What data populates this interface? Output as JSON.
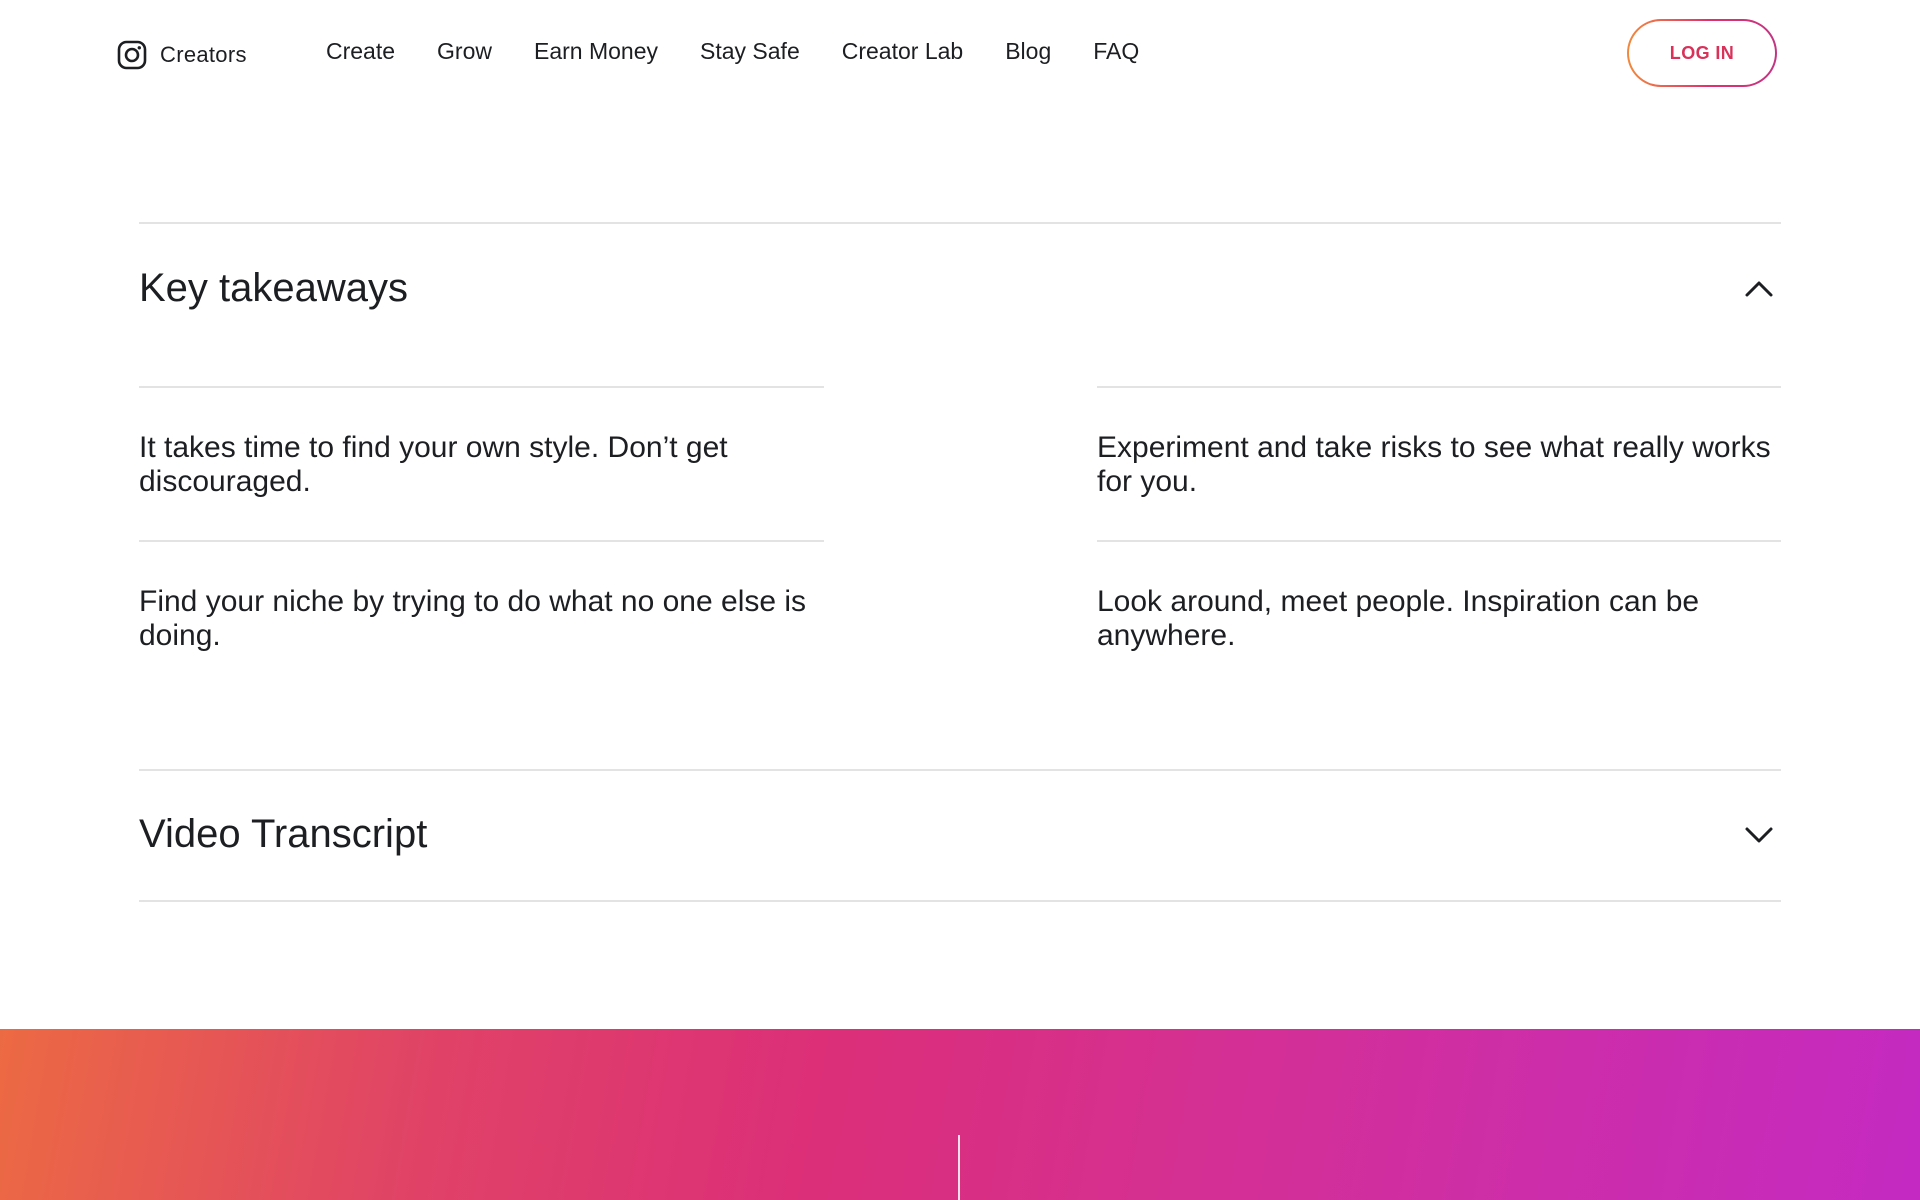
{
  "header": {
    "brand_label": "Creators",
    "brand_icon": "instagram-icon",
    "nav": [
      {
        "label": "Create"
      },
      {
        "label": "Grow"
      },
      {
        "label": "Earn Money"
      },
      {
        "label": "Stay Safe"
      },
      {
        "label": "Creator Lab"
      },
      {
        "label": "Blog"
      },
      {
        "label": "FAQ"
      }
    ],
    "login_label": "LOG IN"
  },
  "key_takeaways": {
    "title": "Key takeaways",
    "expanded": true,
    "toggle_icon": "chevron-up-icon",
    "items": [
      {
        "text": "It takes time to find your own style. Don’t get discouraged."
      },
      {
        "text": "Experiment and take risks to see what really works for you."
      },
      {
        "text": "Find your niche by trying to do what no one else is doing."
      },
      {
        "text": "Look around, meet people. Inspiration can be anywhere."
      }
    ]
  },
  "video_transcript": {
    "title": "Video Transcript",
    "expanded": false,
    "toggle_icon": "chevron-down-icon"
  },
  "colors": {
    "text": "#1c1e21",
    "divider": "#e3e3e3",
    "login_text": "#d8325a",
    "gradient_start": "#ec6a43",
    "gradient_mid": "#dc2f78",
    "gradient_end": "#c42ac2"
  }
}
